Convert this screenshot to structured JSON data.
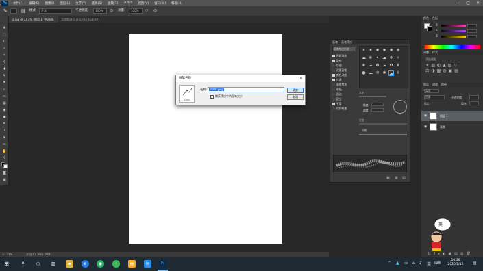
{
  "app": {
    "logo": "Ps"
  },
  "menu": [
    "文件(F)",
    "编辑(E)",
    "图像(I)",
    "图层(L)",
    "文字(Y)",
    "选择(S)",
    "滤镜(T)",
    "3D(D)",
    "视图(V)",
    "窗口(W)",
    "帮助(H)"
  ],
  "window_controls": {
    "minimize": "—",
    "maximize": "▢",
    "close": "✕"
  },
  "options": {
    "mode_label": "模式:",
    "mode_value": "正常",
    "opacity_label": "不透明度:",
    "opacity_value": "100%",
    "flow_label": "流量:",
    "flow_value": "100%"
  },
  "tabs": [
    "2.jpg @ 33.3% (图层 1, RGB/8)",
    "Untitled-1 @ 25% (RGB/8#)"
  ],
  "status": {
    "zoom": "33.33%",
    "doc": "文档:11.3M/3.00M"
  },
  "brush_panel": {
    "tabs": [
      "画笔",
      "画笔预设"
    ],
    "preset_button": "画笔笔尖形状",
    "items": [
      {
        "label": "形状动态",
        "checked": true
      },
      {
        "label": "散布",
        "checked": true
      },
      {
        "label": "纹理",
        "checked": false
      },
      {
        "label": "双重画笔",
        "checked": false
      },
      {
        "label": "颜色动态",
        "checked": true
      },
      {
        "label": "传递",
        "checked": true
      },
      {
        "label": "画笔笔势",
        "checked": false
      },
      {
        "label": "杂色",
        "checked": false
      },
      {
        "label": "湿边",
        "checked": false
      },
      {
        "label": "建立",
        "checked": false
      },
      {
        "label": "平滑",
        "checked": true
      },
      {
        "label": "保护纹理",
        "checked": false
      }
    ],
    "size_label": "大小",
    "angle_label": "角度:",
    "roundness_label": "圆度:",
    "hardness_label": "硬度",
    "spacing_label": "间距"
  },
  "dialog": {
    "title": "画笔名称",
    "close": "✕",
    "name_label": "名称:",
    "name_value": "mask.png",
    "checkbox_label": "捕获预设中的画笔大小",
    "checkbox_checked": "✓",
    "ok": "确定",
    "cancel": "取消",
    "preview_size": "2000"
  },
  "color_panel": {
    "tabs": [
      "颜色",
      "色板"
    ],
    "sliders": [
      {
        "label": "R",
        "color": "#ff3fb0"
      },
      {
        "label": "G",
        "color": "#b04cff"
      },
      {
        "label": "B",
        "color": "#ffcc00"
      }
    ]
  },
  "adjust_panel": {
    "tabs": [
      "调整",
      "样式"
    ],
    "add_label": "添加调整"
  },
  "layers_panel": {
    "tabs": [
      "图层",
      "通道",
      "路径"
    ],
    "kind": "类型",
    "blend": "正常",
    "opacity": "不透明度:",
    "lock": "锁定:",
    "fill": "填充:",
    "layers": [
      {
        "name": "图层 1",
        "selected": true
      },
      {
        "name": "背景",
        "selected": false
      }
    ]
  },
  "taskbar": {
    "ime": "英",
    "time": "16:36",
    "date": "2020/2/12"
  }
}
